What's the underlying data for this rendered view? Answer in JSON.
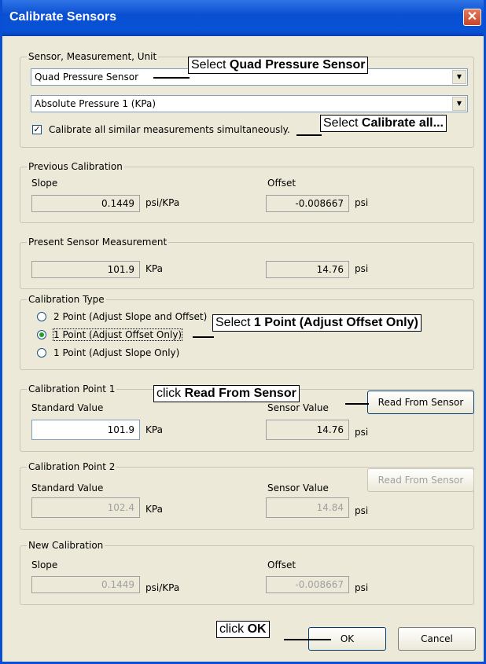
{
  "window": {
    "title": "Calibrate Sensors",
    "close_label": "✕"
  },
  "sensor_group": {
    "legend": "Sensor, Measurement, Unit",
    "sensor_value": "Quad Pressure Sensor",
    "measurement_value": "Absolute Pressure 1 (KPa)",
    "calibrate_all_label": "Calibrate all similar measurements simultaneously.",
    "calibrate_all_checked": true
  },
  "previous_calibration": {
    "legend": "Previous Calibration",
    "slope_label": "Slope",
    "slope_value": "0.1449",
    "slope_unit": "psi/KPa",
    "offset_label": "Offset",
    "offset_value": "-0.008667",
    "offset_unit": "psi"
  },
  "present_measurement": {
    "legend": "Present Sensor Measurement",
    "value1": "101.9",
    "unit1": "KPa",
    "value2": "14.76",
    "unit2": "psi"
  },
  "calibration_type": {
    "legend": "Calibration Type",
    "options": [
      "2 Point (Adjust Slope and Offset)",
      "1 Point (Adjust Offset Only)",
      "1 Point (Adjust Slope Only)"
    ],
    "selected": "1 Point (Adjust Offset Only)"
  },
  "point1": {
    "legend": "Calibration Point 1",
    "standard_label": "Standard Value",
    "standard_value": "101.9",
    "standard_unit": "KPa",
    "sensor_label": "Sensor Value",
    "sensor_value": "14.76",
    "sensor_unit": "psi",
    "read_button": "Read From Sensor"
  },
  "point2": {
    "legend": "Calibration Point 2",
    "standard_label": "Standard Value",
    "standard_value": "102.4",
    "standard_unit": "KPa",
    "sensor_label": "Sensor Value",
    "sensor_value": "14.84",
    "sensor_unit": "psi",
    "read_button": "Read From Sensor"
  },
  "new_calibration": {
    "legend": "New Calibration",
    "slope_label": "Slope",
    "slope_value": "0.1449",
    "slope_unit": "psi/KPa",
    "offset_label": "Offset",
    "offset_value": "-0.008667",
    "offset_unit": "psi"
  },
  "buttons": {
    "ok": "OK",
    "cancel": "Cancel"
  },
  "callouts": {
    "sensor": {
      "prefix": "Select ",
      "bold": "Quad Pressure Sensor"
    },
    "calibrate_all": {
      "prefix": "Select ",
      "bold": "Calibrate all..."
    },
    "one_point": {
      "prefix": "Select ",
      "bold": "1 Point (Adjust Offset Only)"
    },
    "read_sensor": {
      "prefix": "click ",
      "bold": "Read From Sensor"
    },
    "ok": {
      "prefix": "click ",
      "bold": "OK"
    }
  },
  "icons": {
    "dropdown": "chevron-down-icon",
    "close": "close-icon",
    "check": "checkmark-icon"
  }
}
